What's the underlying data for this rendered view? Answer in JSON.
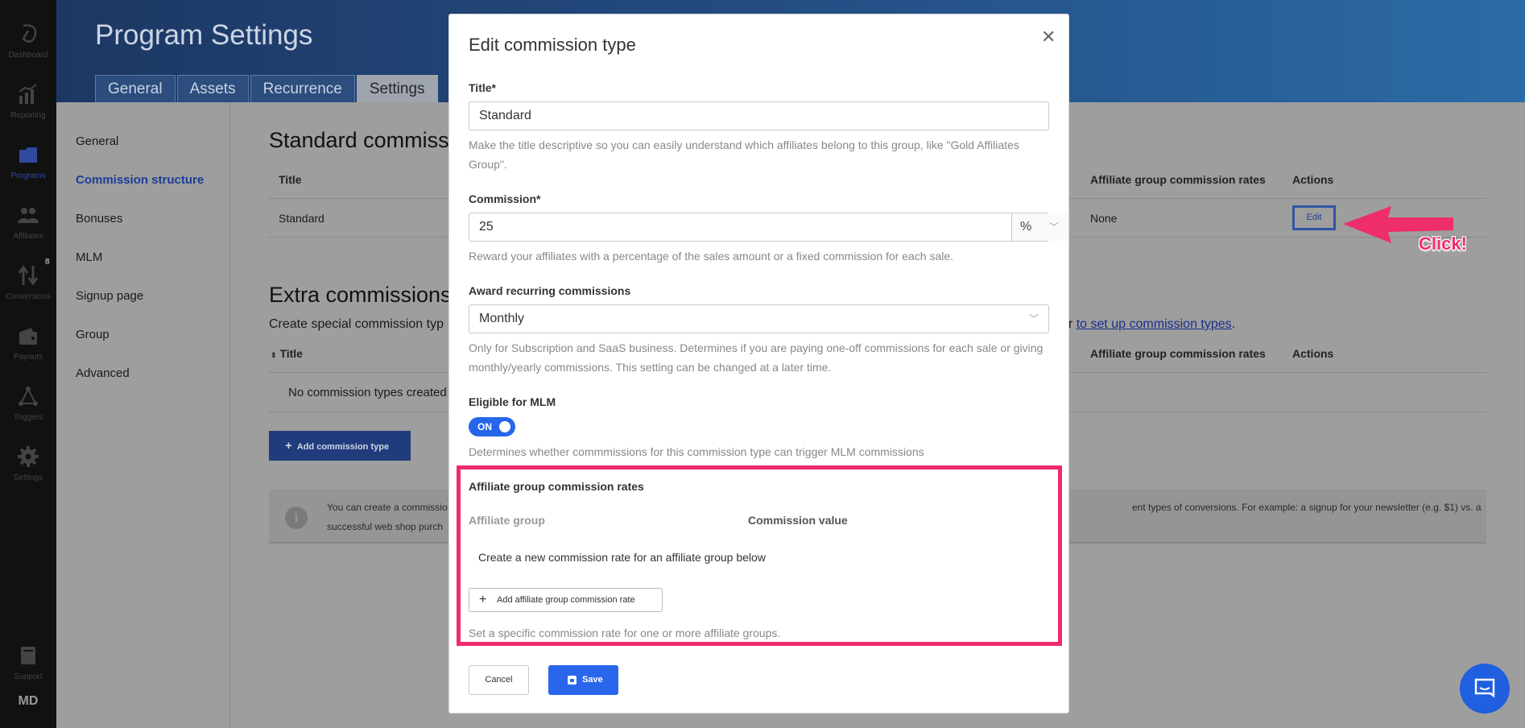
{
  "sidebar": {
    "items": [
      {
        "label": "Dashboard",
        "icon": "logo-icon"
      },
      {
        "label": "Reporting",
        "icon": "bar-chart-icon"
      },
      {
        "label": "Programs",
        "icon": "folder-icon"
      },
      {
        "label": "Affiliates",
        "icon": "users-icon"
      },
      {
        "label": "Conversions",
        "icon": "up-down-arrows-icon",
        "badge": "8"
      },
      {
        "label": "Payouts",
        "icon": "wallet-icon"
      },
      {
        "label": "Triggers",
        "icon": "network-icon"
      },
      {
        "label": "Settings",
        "icon": "gear-icon"
      },
      {
        "label": "Support",
        "icon": "book-icon"
      }
    ],
    "user_initials": "MD"
  },
  "header": {
    "title": "Program Settings",
    "tabs": [
      "General",
      "Assets",
      "Recurrence",
      "Settings"
    ],
    "active_tab": "Settings"
  },
  "left_nav": {
    "items": [
      "General",
      "Commission structure",
      "Bonuses",
      "MLM",
      "Signup page",
      "Group",
      "Advanced"
    ],
    "active": "Commission structure"
  },
  "content": {
    "standard_heading": "Standard commissio",
    "standard_table": {
      "title_col": "Title",
      "group_rates_col": "Affiliate group commission rates",
      "actions_col": "Actions",
      "row": {
        "title": "Standard",
        "group_rates": "None",
        "action": "Edit"
      }
    },
    "extra_heading": "Extra commissions",
    "extra_desc_prefix": "Create special commission typ",
    "extra_desc_suffix": "er",
    "extra_link": "to set up commission types",
    "extra_desc_end": ".",
    "extra_table": {
      "title_col": "Title",
      "group_rates_col": "Affiliate group commission rates",
      "actions_col": "Actions",
      "empty": "No commission types created"
    },
    "add_button": "Add commission type",
    "info": {
      "line1_left": "You can create a commissio",
      "line1_right": "ent types of conversions. For example: a signup for your newsletter (e.g. $1) vs. a",
      "line2_left": "successful web shop purch"
    }
  },
  "annotation": {
    "label": "Click!",
    "color": "#ee2e6a"
  },
  "modal": {
    "title": "Edit commission type",
    "title_field": {
      "label": "Title*",
      "value": "Standard",
      "help": "Make the title descriptive so you can easily understand which affiliates belong to this group, like \"Gold Affiliates Group\"."
    },
    "commission_field": {
      "label": "Commission*",
      "value": "25",
      "unit": "%",
      "help": "Reward your affiliates with a percentage of the sales amount or a fixed commission for each sale."
    },
    "recurring_field": {
      "label": "Award recurring commissions",
      "value": "Monthly",
      "help": "Only for Subscription and SaaS business. Determines if you are paying one-off commissions for each sale or giving monthly/yearly commissions. This setting can be changed at a later time."
    },
    "mlm_field": {
      "label": "Eligible for MLM",
      "toggle": "ON",
      "help": "Determines whether commmissions for this commission type can trigger MLM commissions"
    },
    "affiliate_rates": {
      "title": "Affiliate group commission rates",
      "col_group": "Affiliate group",
      "col_value": "Commission value",
      "empty": "Create a new commission rate for an affiliate group below",
      "add_button": "Add affiliate group commission rate",
      "help": "Set a specific commission rate for one or more affiliate groups."
    },
    "cancel": "Cancel",
    "save": "Save"
  },
  "colors": {
    "accent": "#2a66ec",
    "highlight": "#ee2c6c",
    "header_start": "#1d3763",
    "header_end": "#2b6ba6"
  }
}
